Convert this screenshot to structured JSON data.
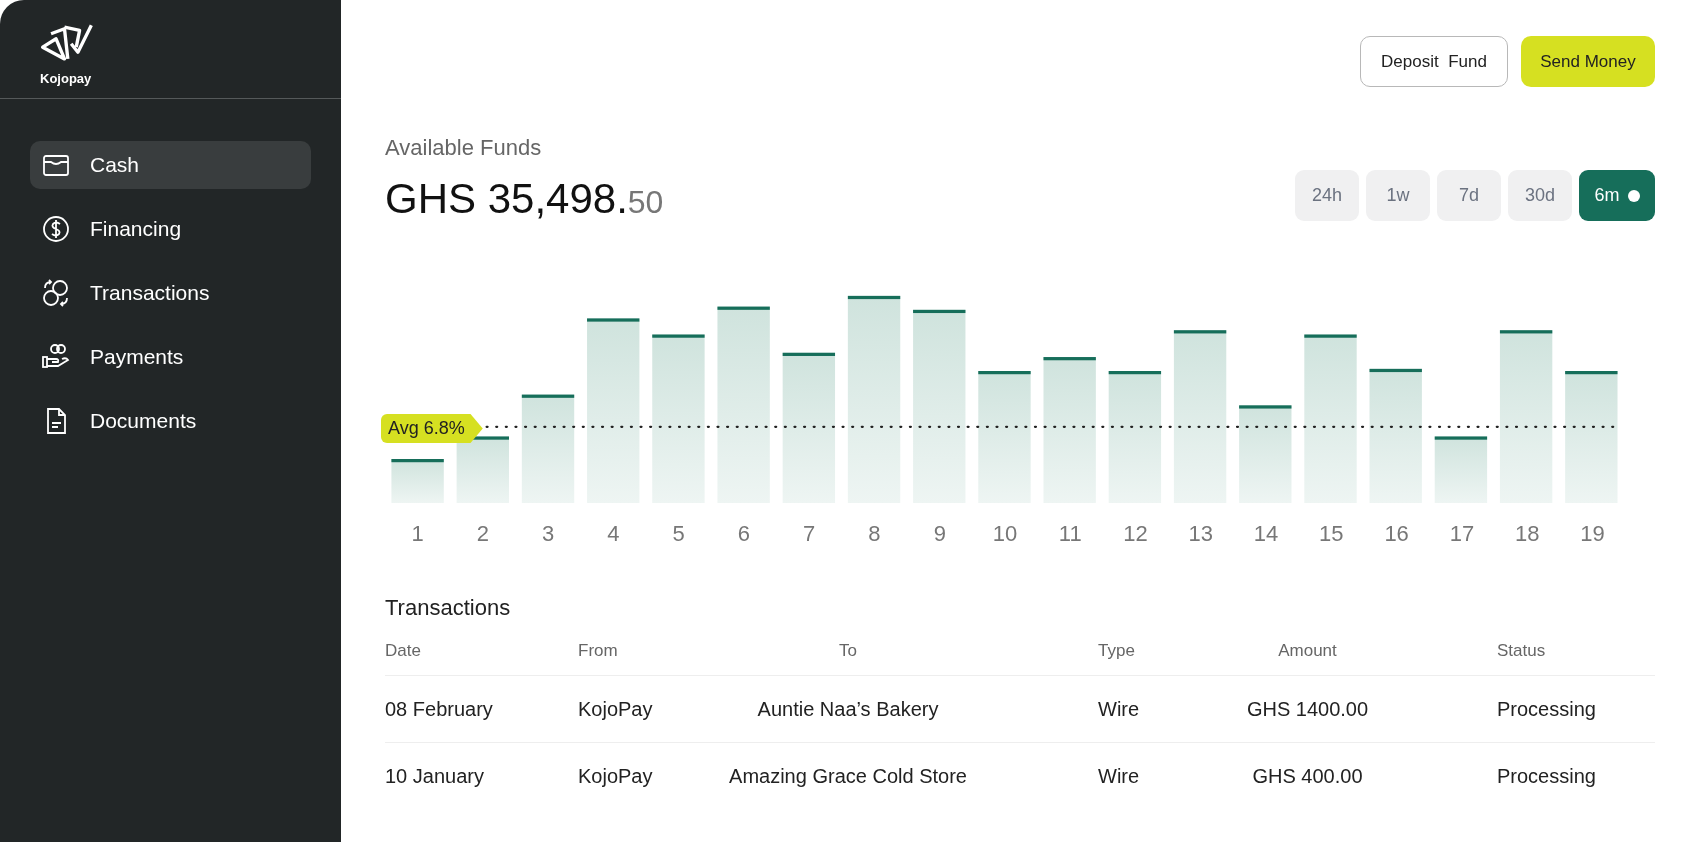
{
  "sidebar": {
    "logo_text": "Kojopay",
    "items": [
      {
        "label": "Cash",
        "selected": true
      },
      {
        "label": "Financing",
        "selected": false
      },
      {
        "label": "Transactions",
        "selected": false
      },
      {
        "label": "Payments",
        "selected": false
      },
      {
        "label": "Documents",
        "selected": false
      }
    ]
  },
  "header": {
    "buttons": [
      {
        "label": "Deposit  Fund",
        "kind": "outline"
      },
      {
        "label": "Send Money",
        "kind": "primary"
      }
    ]
  },
  "balance": {
    "label": "Available Funds",
    "amount": "GHS 35,498.",
    "cents": "50"
  },
  "ranges": [
    {
      "label": "24h",
      "selected": false
    },
    {
      "label": "1w",
      "selected": false
    },
    {
      "label": "7d",
      "selected": false
    },
    {
      "label": "30d",
      "selected": false
    },
    {
      "label": "6m",
      "selected": true
    }
  ],
  "chart": {
    "average_label": "Avg 6.8%",
    "x_labels": [
      "1",
      "2",
      "3",
      "4",
      "5",
      "6",
      "7",
      "8",
      "9",
      "10",
      "11",
      "12",
      "13",
      "14",
      "15",
      "16",
      "17",
      "18",
      "19"
    ]
  },
  "transactions": {
    "title": "Transactions",
    "columns": [
      "Date",
      "From",
      "To",
      "Type",
      "Amount",
      "Status"
    ],
    "rows": [
      [
        "08 February",
        "KojoPay",
        "Auntie Naa’s Bakery",
        "Wire",
        "GHS 1400.00",
        "Processing"
      ],
      [
        "10 January",
        "KojoPay",
        "Amazing Grace Cold Store",
        "Wire",
        "GHS 400.00",
        "Processing"
      ]
    ]
  }
}
